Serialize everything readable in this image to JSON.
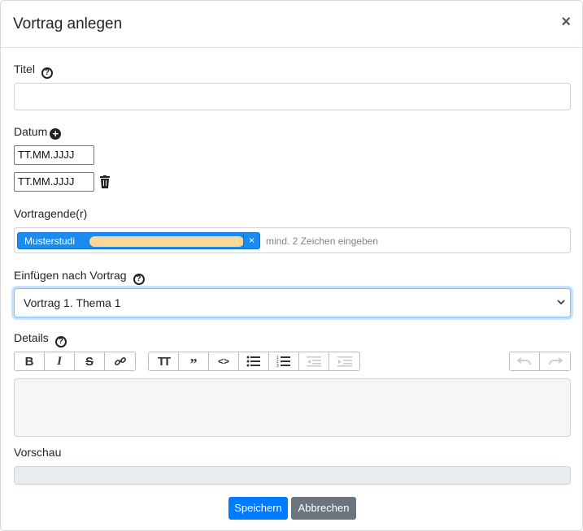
{
  "modal": {
    "title": "Vortrag anlegen",
    "close_label": "×"
  },
  "fields": {
    "titel_label": "Titel",
    "datum_label": "Datum",
    "date_placeholder_1": "TT.MM.JJJJ",
    "date_placeholder_2": "TT.MM.JJJJ",
    "vortragende_label": "Vortragende(r)",
    "vortragende_tag": "Musterstudi",
    "vortragende_hint": "mind. 2 Zeichen eingeben",
    "einfuegen_label": "Einfügen nach Vortrag",
    "einfuegen_value": "Vortrag 1. Thema 1",
    "details_label": "Details",
    "vorschau_label": "Vorschau"
  },
  "toolbar": {
    "group1": [
      "bold-icon",
      "italic-icon",
      "strikethrough-icon",
      "link-icon"
    ],
    "group2": [
      "heading-icon",
      "quote-icon",
      "code-icon",
      "bullet-list-icon",
      "numbered-list-icon",
      "outdent-icon",
      "indent-icon"
    ],
    "group3": [
      "undo-icon",
      "redo-icon"
    ]
  },
  "buttons": {
    "save": "Speichern",
    "cancel": "Abbrechen"
  },
  "colors": {
    "primary": "#007bff",
    "secondary": "#6c757d",
    "tag": "#1a8cf0"
  }
}
